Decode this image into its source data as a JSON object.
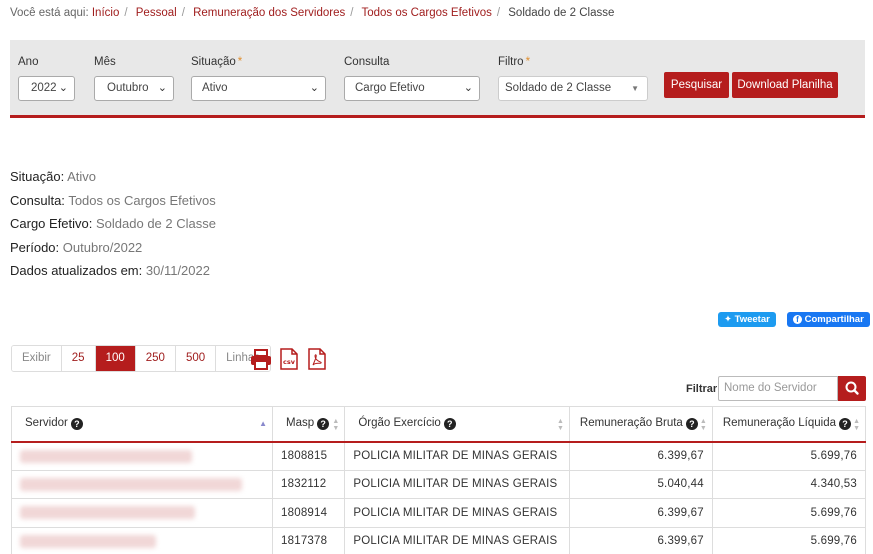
{
  "breadcrumb": {
    "prefix": "Você está aqui:",
    "links": [
      "Início",
      "Pessoal",
      "Remuneração dos Servidores",
      "Todos os Cargos Efetivos"
    ],
    "current": "Soldado de 2 Classe"
  },
  "filters": {
    "ano": {
      "label": "Ano",
      "value": "2022"
    },
    "mes": {
      "label": "Mês",
      "value": "Outubro"
    },
    "situacao": {
      "label": "Situação",
      "required": "*",
      "value": "Ativo"
    },
    "consulta": {
      "label": "Consulta",
      "value": "Cargo Efetivo"
    },
    "filtro": {
      "label": "Filtro",
      "required": "*",
      "value": "Soldado de 2 Classe"
    },
    "pesquisar_label": "Pesquisar",
    "download_label": "Download Planilha"
  },
  "info": [
    {
      "label": "Situação:",
      "value": "Ativo"
    },
    {
      "label": "Consulta:",
      "value": "Todos os Cargos Efetivos"
    },
    {
      "label": "Cargo Efetivo:",
      "value": "Soldado de 2 Classe"
    },
    {
      "label": "Período:",
      "value": "Outubro/2022"
    },
    {
      "label": "Dados atualizados em:",
      "value": "30/11/2022"
    }
  ],
  "share": {
    "tweet": "Tweetar",
    "facebook": "Compartilhar"
  },
  "pager": {
    "exibir": "Exibir",
    "options": [
      "25",
      "100",
      "250",
      "500"
    ],
    "selected": "100",
    "linhas": "Linhas"
  },
  "export_icons": [
    "print-icon",
    "csv-icon",
    "pdf-icon"
  ],
  "search": {
    "label": "Filtrar:",
    "placeholder": "Nome do Servidor"
  },
  "table": {
    "headers": [
      "Servidor",
      "Masp",
      "Órgão Exercício",
      "Remuneração Bruta",
      "Remuneração Líquida"
    ],
    "rows": [
      {
        "masp": "1808815",
        "orgao": "POLICIA MILITAR DE MINAS GERAIS",
        "bruta": "6.399,67",
        "liquida": "5.699,76"
      },
      {
        "masp": "1832112",
        "orgao": "POLICIA MILITAR DE MINAS GERAIS",
        "bruta": "5.040,44",
        "liquida": "4.340,53"
      },
      {
        "masp": "1808914",
        "orgao": "POLICIA MILITAR DE MINAS GERAIS",
        "bruta": "6.399,67",
        "liquida": "5.699,76"
      },
      {
        "masp": "1817378",
        "orgao": "POLICIA MILITAR DE MINAS GERAIS",
        "bruta": "6.399,67",
        "liquida": "5.699,76"
      }
    ]
  },
  "colors": {
    "accent": "#b51d1d",
    "link": "#a01e1e",
    "panel": "#e8e8e8",
    "twitter": "#1d9bf0",
    "facebook": "#1877f2"
  }
}
